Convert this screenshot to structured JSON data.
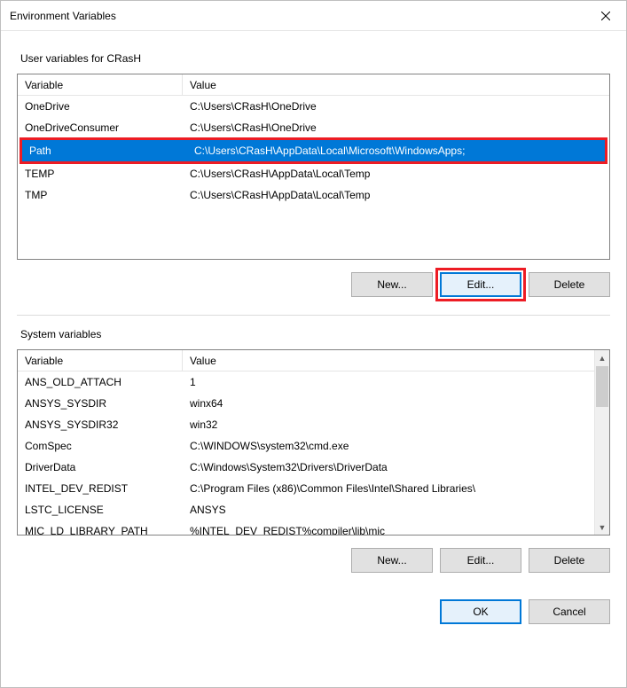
{
  "title": "Environment Variables",
  "user_section_label": "User variables for CRasH",
  "sys_section_label": "System variables",
  "col_var": "Variable",
  "col_val": "Value",
  "user_vars": [
    {
      "name": "OneDrive",
      "value": "C:\\Users\\CRasH\\OneDrive"
    },
    {
      "name": "OneDriveConsumer",
      "value": "C:\\Users\\CRasH\\OneDrive"
    },
    {
      "name": "Path",
      "value": "C:\\Users\\CRasH\\AppData\\Local\\Microsoft\\WindowsApps;"
    },
    {
      "name": "TEMP",
      "value": "C:\\Users\\CRasH\\AppData\\Local\\Temp"
    },
    {
      "name": "TMP",
      "value": "C:\\Users\\CRasH\\AppData\\Local\\Temp"
    }
  ],
  "user_selected_index": 2,
  "sys_vars": [
    {
      "name": "ANS_OLD_ATTACH",
      "value": "1"
    },
    {
      "name": "ANSYS_SYSDIR",
      "value": "winx64"
    },
    {
      "name": "ANSYS_SYSDIR32",
      "value": "win32"
    },
    {
      "name": "ComSpec",
      "value": "C:\\WINDOWS\\system32\\cmd.exe"
    },
    {
      "name": "DriverData",
      "value": "C:\\Windows\\System32\\Drivers\\DriverData"
    },
    {
      "name": "INTEL_DEV_REDIST",
      "value": "C:\\Program Files (x86)\\Common Files\\Intel\\Shared Libraries\\"
    },
    {
      "name": "LSTC_LICENSE",
      "value": "ANSYS"
    },
    {
      "name": "MIC_LD_LIBRARY_PATH",
      "value": "%INTEL_DEV_REDIST%compiler\\lib\\mic"
    }
  ],
  "buttons": {
    "new": "New...",
    "edit": "Edit...",
    "delete": "Delete",
    "ok": "OK",
    "cancel": "Cancel"
  }
}
